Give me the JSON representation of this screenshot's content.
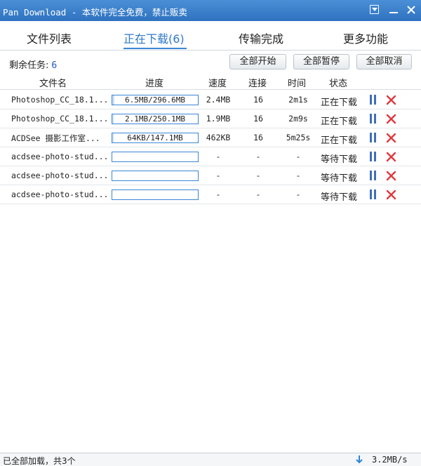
{
  "window": {
    "title": "Pan Download - 本软件完全免费，禁止贩卖"
  },
  "tabs": [
    {
      "label": "文件列表"
    },
    {
      "label": "正在下载(6)"
    },
    {
      "label": "传输完成"
    },
    {
      "label": "更多功能"
    }
  ],
  "toolbar": {
    "remaining_label": "剩余任务:",
    "remaining_count": "6",
    "start_all": "全部开始",
    "pause_all": "全部暂停",
    "cancel_all": "全部取消"
  },
  "columns": [
    "文件名",
    "进度",
    "速度",
    "连接",
    "时间",
    "状态"
  ],
  "rows": [
    {
      "name": "Photoshop_CC_18.1...",
      "progress_text": "6.5MB/296.6MB",
      "progress": 0.022,
      "speed": "2.4MB",
      "conn": "16",
      "time": "2m1s",
      "status": "正在下载"
    },
    {
      "name": "Photoshop_CC_18.1...",
      "progress_text": "2.1MB/250.1MB",
      "progress": 0.008,
      "speed": "1.9MB",
      "conn": "16",
      "time": "2m9s",
      "status": "正在下载"
    },
    {
      "name": "ACDSee 摄影工作室...",
      "progress_text": "64KB/147.1MB",
      "progress": 0.0004,
      "speed": "462KB",
      "conn": "16",
      "time": "5m25s",
      "status": "正在下载"
    },
    {
      "name": "acdsee-photo-stud...",
      "progress_text": "",
      "progress": 0,
      "speed": "-",
      "conn": "-",
      "time": "-",
      "status": "等待下载"
    },
    {
      "name": "acdsee-photo-stud...",
      "progress_text": "",
      "progress": 0,
      "speed": "-",
      "conn": "-",
      "time": "-",
      "status": "等待下载"
    },
    {
      "name": "acdsee-photo-stud...",
      "progress_text": "",
      "progress": 0,
      "speed": "-",
      "conn": "-",
      "time": "-",
      "status": "等待下载"
    }
  ],
  "statusbar": {
    "left_text": "已全部加载，共3个",
    "speed": "3.2MB/s"
  },
  "colors": {
    "titlebar": "#3a7fcf",
    "accent": "#2d78c8",
    "delete": "#e0383e",
    "pause": "#3f6fb5"
  },
  "icons": {
    "pause": "pause-icon",
    "delete": "delete-icon",
    "download": "download-arrow-icon"
  }
}
